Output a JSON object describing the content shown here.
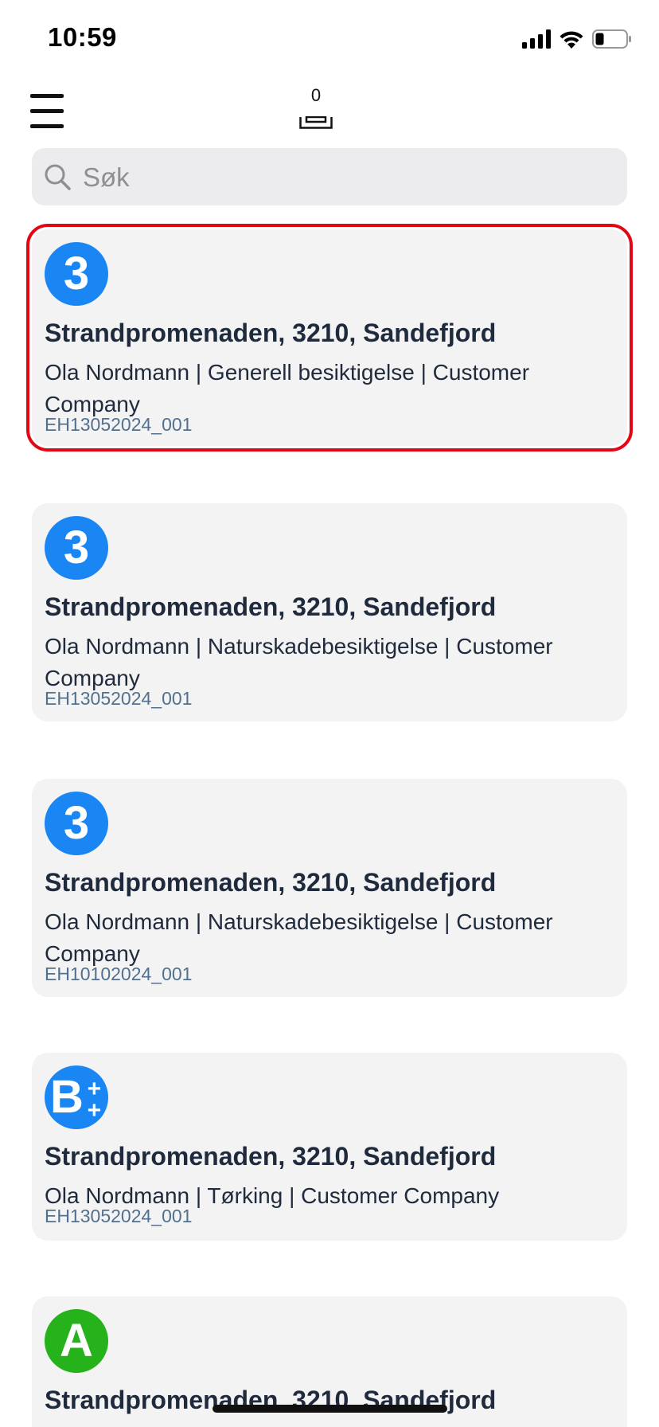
{
  "status_bar": {
    "time": "10:59"
  },
  "toolbar": {
    "cart_count": "0"
  },
  "search": {
    "placeholder": "Søk"
  },
  "cards": [
    {
      "badge": "3",
      "title": "Strandpromenaden, 3210, Sandefjord",
      "description": "Ola Nordmann | Generell besiktigelse | Customer Company",
      "id": "EH13052024_001",
      "selected": true,
      "badge_color": "#1a86f3"
    },
    {
      "badge": "3",
      "title": "Strandpromenaden, 3210, Sandefjord",
      "description": "Ola Nordmann | Naturskadebesiktigelse | Customer Company",
      "id": "EH13052024_001",
      "badge_color": "#1a86f3"
    },
    {
      "badge": "3",
      "title": "Strandpromenaden, 3210, Sandefjord",
      "description": "Ola Nordmann | Naturskadebesiktigelse | Customer Company",
      "id": "EH10102024_001",
      "badge_color": "#1a86f3"
    },
    {
      "badge": "B",
      "badge_suffix": "++",
      "title": "Strandpromenaden, 3210, Sandefjord",
      "description": "Ola Nordmann | Tørking | Customer Company",
      "id": "EH13052024_001",
      "badge_color": "#1a86f3"
    },
    {
      "badge": "A",
      "title": "Strandpromenaden, 3210, Sandefjord",
      "badge_color": "#25b21b"
    }
  ]
}
